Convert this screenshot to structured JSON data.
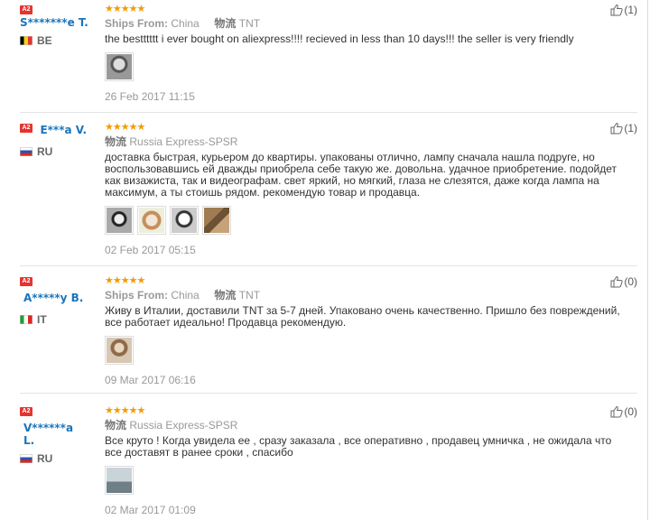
{
  "reviews": [
    {
      "badge": "A2",
      "username": "S*******e T.",
      "country_code": "BE",
      "country_label": "BE",
      "stars": "★★★★★",
      "ships_from_label": "Ships From:",
      "ships_from": "China",
      "logistics_label": "物流",
      "logistics": "TNT",
      "text": "the bestttttt i ever bought on aliexpress!!!! recieved in less than 10 days!!! the seller is very friendly",
      "date": "26 Feb 2017 11:15",
      "likes": "(1)",
      "photos": [
        "t1"
      ]
    },
    {
      "badge": "A2",
      "username": "E***a V.",
      "country_code": "RU",
      "country_label": "RU",
      "stars": "★★★★★",
      "ships_from_label": "",
      "ships_from": "",
      "logistics_label": "物流",
      "logistics": "Russia Express-SPSR",
      "text": "доставка быстрая, курьером до квартиры. упакованы отлично, лампу сначала нашла подруге, но воспользовавшись ей дважды приобрела себе такую же. довольна. удачное приобретение. подойдет как визажиста, так и видеографам. свет яркий, но мягкий, глаза не слезятся, даже когда лампа на максимум, а ты стоишь рядом. рекомендую товар и продавца.",
      "date": "02 Feb 2017 05:15",
      "likes": "(1)",
      "photos": [
        "t2",
        "t3",
        "t4",
        "t5"
      ]
    },
    {
      "badge": "A2",
      "username": "A*****y B.",
      "country_code": "IT",
      "country_label": "IT",
      "stars": "★★★★★",
      "ships_from_label": "Ships From:",
      "ships_from": "China",
      "logistics_label": "物流",
      "logistics": "TNT",
      "text": "Живу в Италии, доставили TNT за 5-7 дней. Упаковано очень качественно. Пришло без повреждений, все работает идеально! Продавца рекомендую.",
      "date": "09 Mar 2017 06:16",
      "likes": "(0)",
      "photos": [
        "t6"
      ]
    },
    {
      "badge": "A2",
      "username": "V******a L.",
      "country_code": "RU",
      "country_label": "RU",
      "stars": "★★★★★",
      "ships_from_label": "",
      "ships_from": "",
      "logistics_label": "物流",
      "logistics": "Russia Express-SPSR",
      "text": "Все круто ! Когда увидела ее , сразу заказала , все оперативно , продавец умничка , не ожидала что все доставят в ранее сроки , спасибо",
      "date": "02 Mar 2017 01:09",
      "likes": "(0)",
      "photos": [
        "t7"
      ]
    }
  ]
}
